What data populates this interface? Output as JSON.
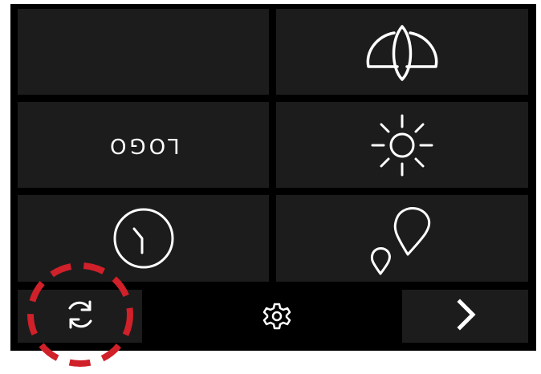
{
  "tiles": {
    "logo_text": "LOGO",
    "empty_tile": "",
    "leaf_icon": "lotus-leaf-icon",
    "sun_icon": "sun-icon",
    "clock_icon": "clock-icon",
    "drops_icon": "water-drops-icon"
  },
  "toolbar": {
    "refresh_icon": "refresh-icon",
    "settings_icon": "gear-icon",
    "next_icon": "chevron-right-icon"
  },
  "colors": {
    "background": "#000000",
    "tile": "#1c1c1c",
    "foreground": "#ffffff",
    "highlight": "#d0202a"
  }
}
